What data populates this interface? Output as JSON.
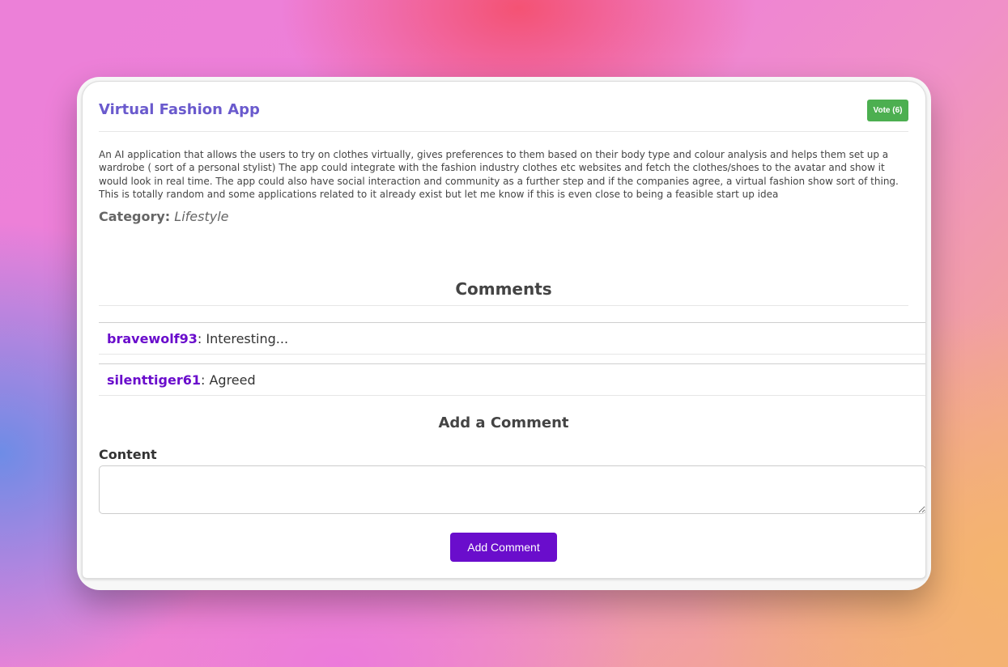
{
  "idea": {
    "title": "Virtual Fashion App",
    "vote_label": "Vote (6)",
    "description": "An AI application that allows the users to try on clothes virtually, gives preferences to them based on their body type and colour analysis and helps them set up a wardrobe ( sort of a personal stylist) The app could integrate with the fashion industry clothes etc websites and fetch the clothes/shoes to the avatar and show it would look in real time. The app could also have social interaction and community as a further step and if the companies agree, a virtual fashion show sort of thing. This is totally random and some applications related to it already exist but let me know if this is even close to being a feasible start up idea",
    "category_label": "Category:",
    "category_value": "Lifestyle"
  },
  "comments": {
    "heading": "Comments",
    "items": [
      {
        "author": "bravewolf93",
        "separator": ":",
        "text": " Interesting..."
      },
      {
        "author": "silenttiger61",
        "separator": ":",
        "text": " Agreed"
      }
    ]
  },
  "add_comment": {
    "heading": "Add a Comment",
    "content_label": "Content",
    "content_value": "",
    "button_label": "Add Comment"
  },
  "colors": {
    "title": "#6a5acd",
    "vote_button": "#4caf50",
    "author": "#6a0dcc",
    "primary_button": "#6a0dcc"
  }
}
